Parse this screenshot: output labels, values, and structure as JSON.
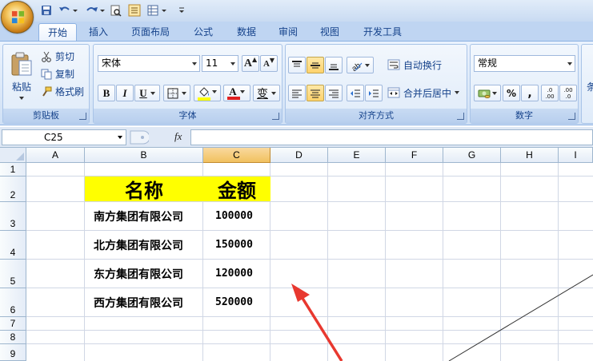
{
  "ribbon": {
    "tabs": [
      {
        "label": "开始",
        "active": true
      },
      {
        "label": "插入",
        "active": false
      },
      {
        "label": "页面布局",
        "active": false
      },
      {
        "label": "公式",
        "active": false
      },
      {
        "label": "数据",
        "active": false
      },
      {
        "label": "审阅",
        "active": false
      },
      {
        "label": "视图",
        "active": false
      },
      {
        "label": "开发工具",
        "active": false
      }
    ],
    "clipboard": {
      "paste_label": "粘贴",
      "cut_label": "剪切",
      "copy_label": "复制",
      "format_painter_label": "格式刷",
      "group_label": "剪贴板"
    },
    "font": {
      "font_name": "宋体",
      "font_size": "11",
      "bold_label": "B",
      "italic_label": "I",
      "underline_label": "U",
      "grow_label": "A",
      "shrink_label": "A",
      "font_color_label": "A",
      "phonetic_label": "变",
      "group_label": "字体",
      "font_color": "#e02020",
      "fill_color": "#ffff00"
    },
    "alignment": {
      "wrap_text_label": "自动换行",
      "merge_center_label": "合并后居中",
      "group_label": "对齐方式"
    },
    "number": {
      "format_value": "常规",
      "percent_label": "%",
      "comma_label": ",",
      "increase_decimal_label": ".0 .00",
      "decrease_decimal_label": ".00 .0",
      "group_label": "数字"
    },
    "cutoff_group_label": "条"
  },
  "formula_bar": {
    "name_box_value": "C25",
    "fx_label": "fx",
    "formula_value": ""
  },
  "sheet": {
    "columns": [
      "A",
      "B",
      "C",
      "D",
      "E",
      "F",
      "G",
      "H",
      "I"
    ],
    "selected_column": "C",
    "rows": [
      "1",
      "2",
      "3",
      "4",
      "5",
      "6",
      "7",
      "8",
      "9"
    ],
    "header_row": {
      "name": "名称",
      "amount": "金额"
    },
    "header_fill": "#ffff00",
    "records": [
      {
        "name": "南方集团有限公司",
        "amount": "100000"
      },
      {
        "name": "北方集团有限公司",
        "amount": "150000"
      },
      {
        "name": "东方集团有限公司",
        "amount": "120000"
      },
      {
        "name": "西方集团有限公司",
        "amount": "520000"
      }
    ]
  },
  "annotation": {
    "arrow_color": "#e8382f"
  }
}
